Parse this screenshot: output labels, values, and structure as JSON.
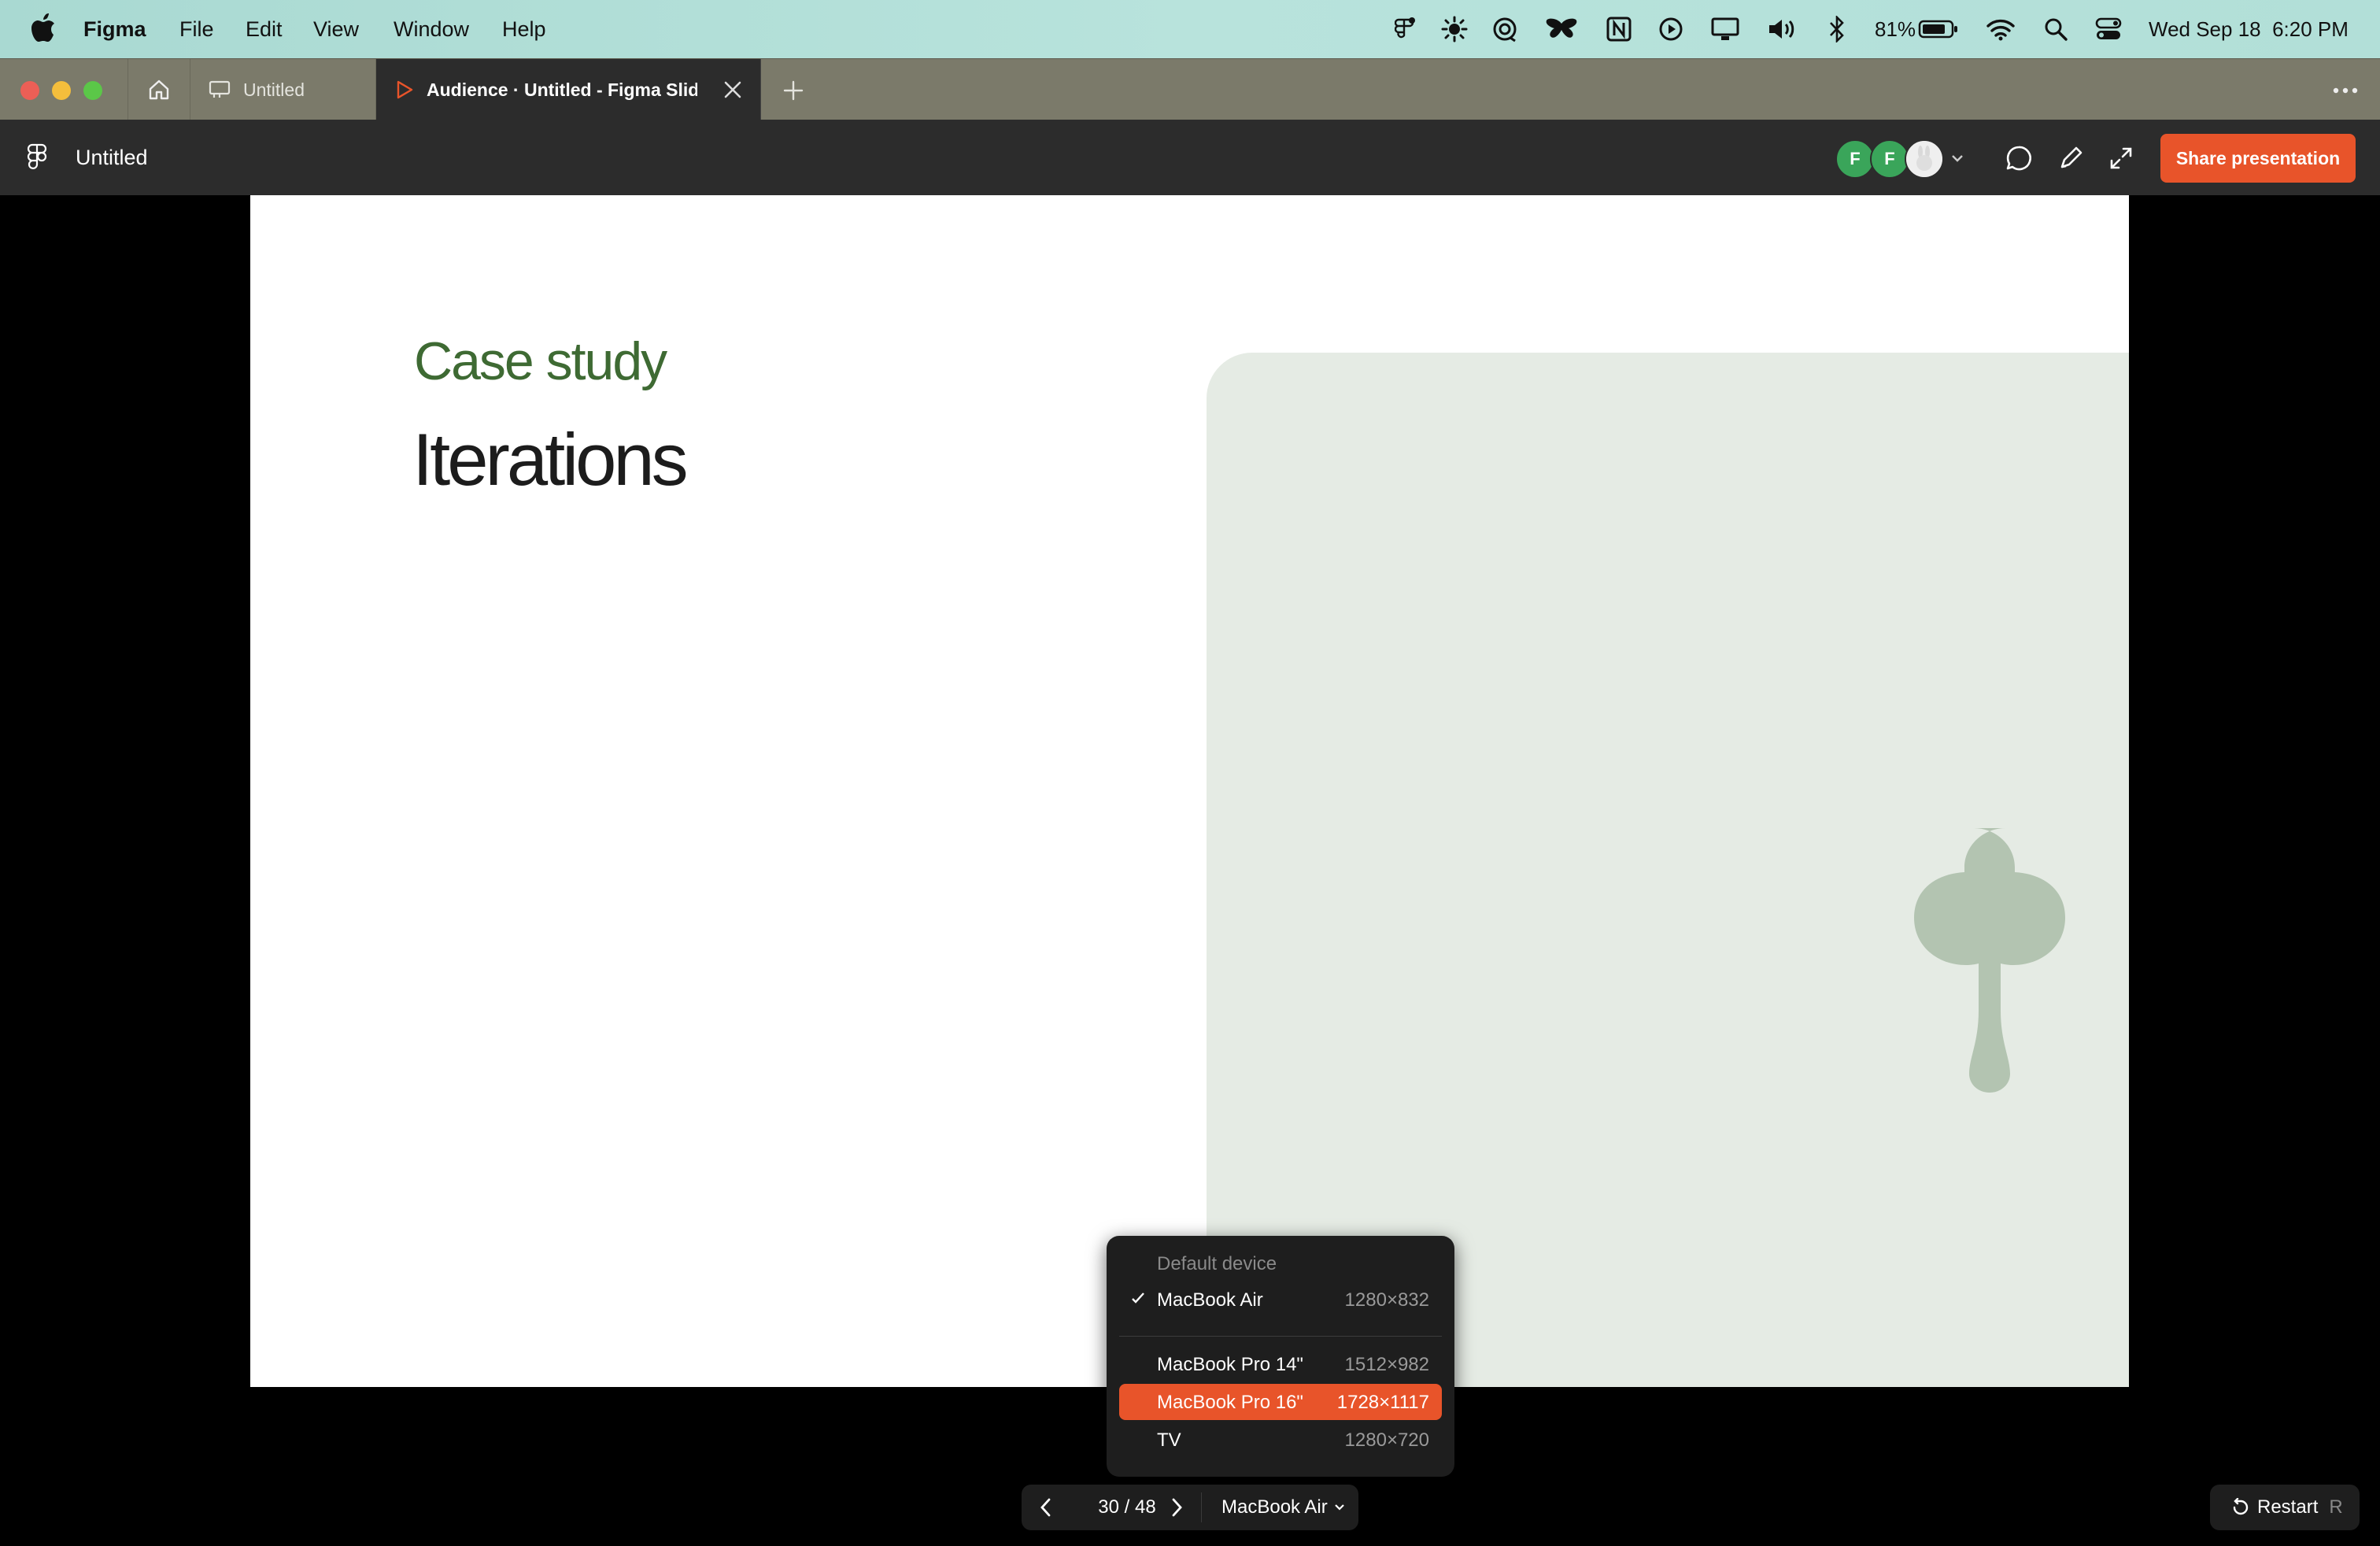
{
  "menubar": {
    "app_name": "Figma",
    "menus": [
      "File",
      "Edit",
      "View",
      "Window",
      "Help"
    ],
    "battery": "81%",
    "datetime": "Wed Sep 18  6:20 PM",
    "icons": [
      "figma-agent-icon",
      "sun-icon",
      "sync-icon",
      "butterfly-icon",
      "notion-icon",
      "play-icon",
      "display-icon",
      "volume-icon",
      "bluetooth-icon",
      "battery-icon",
      "wifi-icon",
      "search-icon",
      "control-center-icon"
    ]
  },
  "tabs": {
    "home_icon": "home-icon",
    "items": [
      {
        "label": "Untitled",
        "icon": "slides-icon",
        "active": false
      },
      {
        "label": "Audience · Untitled - Figma Slides",
        "icon": "play-icon",
        "active": true
      }
    ]
  },
  "toolbar": {
    "doc_title": "Untitled",
    "avatars": [
      {
        "initial": "F",
        "color": "#3aa55a"
      },
      {
        "initial": "F",
        "color": "#3aa55a"
      }
    ],
    "share_label": "Share presentation",
    "share_color": "#e8542a"
  },
  "slide": {
    "kicker": "Case study",
    "title": "Iterations",
    "kicker_color": "#3e6a33",
    "panel_color": "#e5ebe4",
    "shape_color": "#b3c4b1"
  },
  "device_menu": {
    "header": "Default device",
    "items": [
      {
        "name": "MacBook Air",
        "res": "1280×832",
        "checked": true,
        "highlighted": false
      },
      {
        "name": "MacBook Pro 14\"",
        "res": "1512×982",
        "checked": false,
        "highlighted": false
      },
      {
        "name": "MacBook Pro 16\"",
        "res": "1728×1117",
        "checked": false,
        "highlighted": true
      },
      {
        "name": "TV",
        "res": "1280×720",
        "checked": false,
        "highlighted": false
      }
    ]
  },
  "pager": {
    "count": "30 / 48",
    "device": "MacBook Air"
  },
  "restart": {
    "label": "Restart",
    "shortcut": "R"
  }
}
